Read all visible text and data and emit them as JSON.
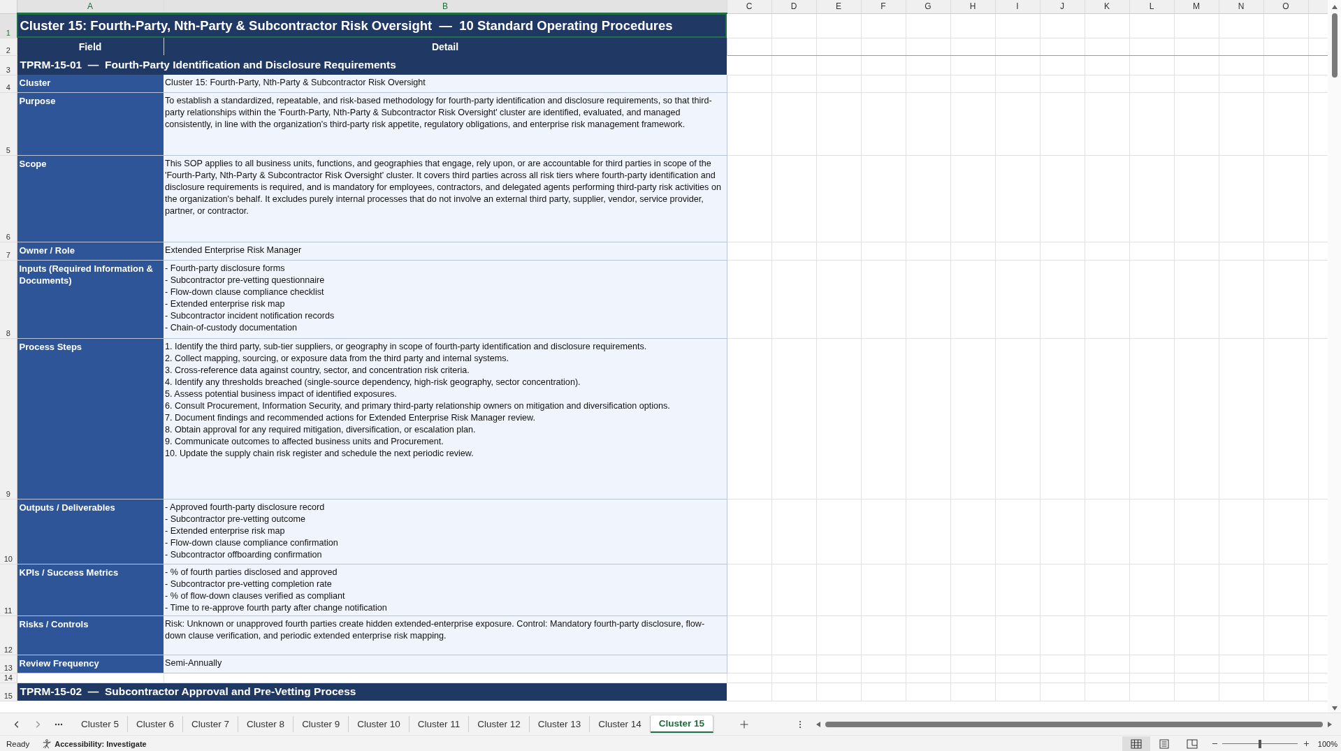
{
  "columns": [
    "A",
    "B",
    "C",
    "D",
    "E",
    "F",
    "G",
    "H",
    "I",
    "J",
    "K",
    "L",
    "M",
    "N",
    "O"
  ],
  "row_numbers": [
    "1",
    "2",
    "3",
    "4",
    "5",
    "6",
    "7",
    "8",
    "9",
    "10",
    "11",
    "12",
    "13",
    "14",
    "15"
  ],
  "title": "Cluster 15: Fourth-Party, Nth-Party & Subcontractor Risk Oversight  —  10 Standard Operating Procedures",
  "header": {
    "field": "Field",
    "detail": "Detail"
  },
  "procedures": [
    {
      "heading": "TPRM-15-01  —  Fourth-Party Identification and Disclosure Requirements",
      "fields": [
        {
          "label": "Cluster",
          "kind": "text",
          "text": "Cluster 15: Fourth-Party, Nth-Party & Subcontractor Risk Oversight"
        },
        {
          "label": "Purpose",
          "kind": "text",
          "text": "To establish a standardized, repeatable, and risk-based methodology for fourth-party identification and disclosure requirements, so that third-party relationships within the 'Fourth-Party, Nth-Party & Subcontractor Risk Oversight' cluster are identified, evaluated, and managed consistently, in line with the organization's third-party risk appetite, regulatory obligations, and enterprise risk management framework."
        },
        {
          "label": "Scope",
          "kind": "text",
          "text": "This SOP applies to all business units, functions, and geographies that engage, rely upon, or are accountable for third parties in scope of the 'Fourth-Party, Nth-Party & Subcontractor Risk Oversight' cluster. It covers third parties across all risk tiers where fourth-party identification and disclosure requirements is required, and is mandatory for employees, contractors, and delegated agents performing third-party risk activities on the organization's behalf. It excludes purely internal processes that do not involve an external third party, supplier, vendor, service provider, partner, or contractor."
        },
        {
          "label": "Owner / Role",
          "kind": "text",
          "text": "Extended Enterprise Risk Manager"
        },
        {
          "label": "Inputs (Required Information & Documents)",
          "kind": "list",
          "items": [
            "- Fourth-party disclosure forms",
            "- Subcontractor pre-vetting questionnaire",
            "- Flow-down clause compliance checklist",
            "- Extended enterprise risk map",
            "- Subcontractor incident notification records",
            "- Chain-of-custody documentation"
          ]
        },
        {
          "label": "Process Steps",
          "kind": "list",
          "items": [
            "1. Identify the third party, sub-tier suppliers, or geography in scope of fourth-party identification and disclosure requirements.",
            "2. Collect mapping, sourcing, or exposure data from the third party and internal systems.",
            "3. Cross-reference data against country, sector, and concentration risk criteria.",
            "4. Identify any thresholds breached (single-source dependency, high-risk geography, sector concentration).",
            "5. Assess potential business impact of identified exposures.",
            "6. Consult Procurement, Information Security, and primary third-party relationship owners on mitigation and diversification options.",
            "7. Document findings and recommended actions for Extended Enterprise Risk Manager review.",
            "8. Obtain approval for any required mitigation, diversification, or escalation plan.",
            "9. Communicate outcomes to affected business units and Procurement.",
            "10. Update the supply chain risk register and schedule the next periodic review."
          ]
        },
        {
          "label": "Outputs / Deliverables",
          "kind": "list",
          "items": [
            "- Approved fourth-party disclosure record",
            "- Subcontractor pre-vetting outcome",
            "- Extended enterprise risk map",
            "- Flow-down clause compliance confirmation",
            "- Subcontractor offboarding confirmation"
          ]
        },
        {
          "label": "KPIs / Success Metrics",
          "kind": "list",
          "items": [
            "- % of fourth parties disclosed and approved",
            "- Subcontractor pre-vetting completion rate",
            "- % of flow-down clauses verified as compliant",
            "- Time to re-approve fourth party after change notification"
          ]
        },
        {
          "label": "Risks / Controls",
          "kind": "text",
          "text": "Risk: Unknown or unapproved fourth parties create hidden extended-enterprise exposure. Control: Mandatory fourth-party disclosure, flow-down clause verification, and periodic extended enterprise risk mapping."
        },
        {
          "label": "Review Frequency",
          "kind": "text",
          "text": "Semi-Annually"
        }
      ]
    },
    {
      "heading": "TPRM-15-02  —  Subcontractor Approval and Pre-Vetting Process"
    }
  ],
  "sheet_tabs": [
    {
      "label": "Cluster 5",
      "selected": false
    },
    {
      "label": "Cluster 6",
      "selected": false
    },
    {
      "label": "Cluster 7",
      "selected": false
    },
    {
      "label": "Cluster 8",
      "selected": false
    },
    {
      "label": "Cluster 9",
      "selected": false
    },
    {
      "label": "Cluster 10",
      "selected": false
    },
    {
      "label": "Cluster 11",
      "selected": false
    },
    {
      "label": "Cluster 12",
      "selected": false
    },
    {
      "label": "Cluster 13",
      "selected": false
    },
    {
      "label": "Cluster 14",
      "selected": false
    },
    {
      "label": "Cluster 15",
      "selected": true
    }
  ],
  "status_bar": {
    "mode": "Ready",
    "accessibility": "Accessibility: Investigate",
    "zoom": "100%",
    "zoom_slider": {
      "level": 0.5
    }
  }
}
